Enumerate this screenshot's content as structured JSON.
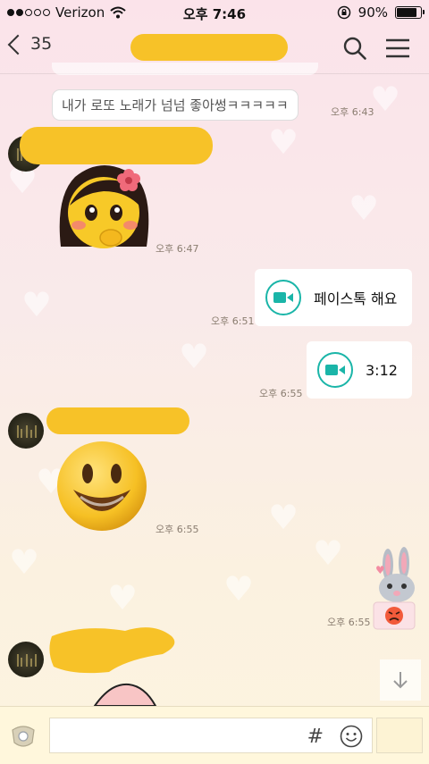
{
  "status_bar": {
    "carrier": "Verizon",
    "time": "오후 7:46",
    "battery_text": "90%",
    "battery_level": 0.9
  },
  "header": {
    "back_count": "35",
    "search_icon": "search-icon",
    "menu_icon": "hamburger-menu-icon"
  },
  "messages": {
    "msg1_text": "내가 로또 노래가 넘넘 좋아썽ㅋㅋㅋㅋㅋ",
    "msg1_time": "오후 6:43",
    "msg2_time": "오후 6:47",
    "msg3_text": "페이스톡 해요",
    "msg3_time": "오후 6:51",
    "msg4_text": "3:12",
    "msg4_time": "오후 6:55",
    "msg5_time": "오후 6:55",
    "msg6_time": "오후 6:55"
  },
  "input": {
    "hash_label": "#",
    "emoji_icon": "smiley-icon",
    "scroll_icon": "arrow-down-icon"
  },
  "colors": {
    "accent_yellow": "#f7c228",
    "video_teal": "#1ab5a8"
  }
}
